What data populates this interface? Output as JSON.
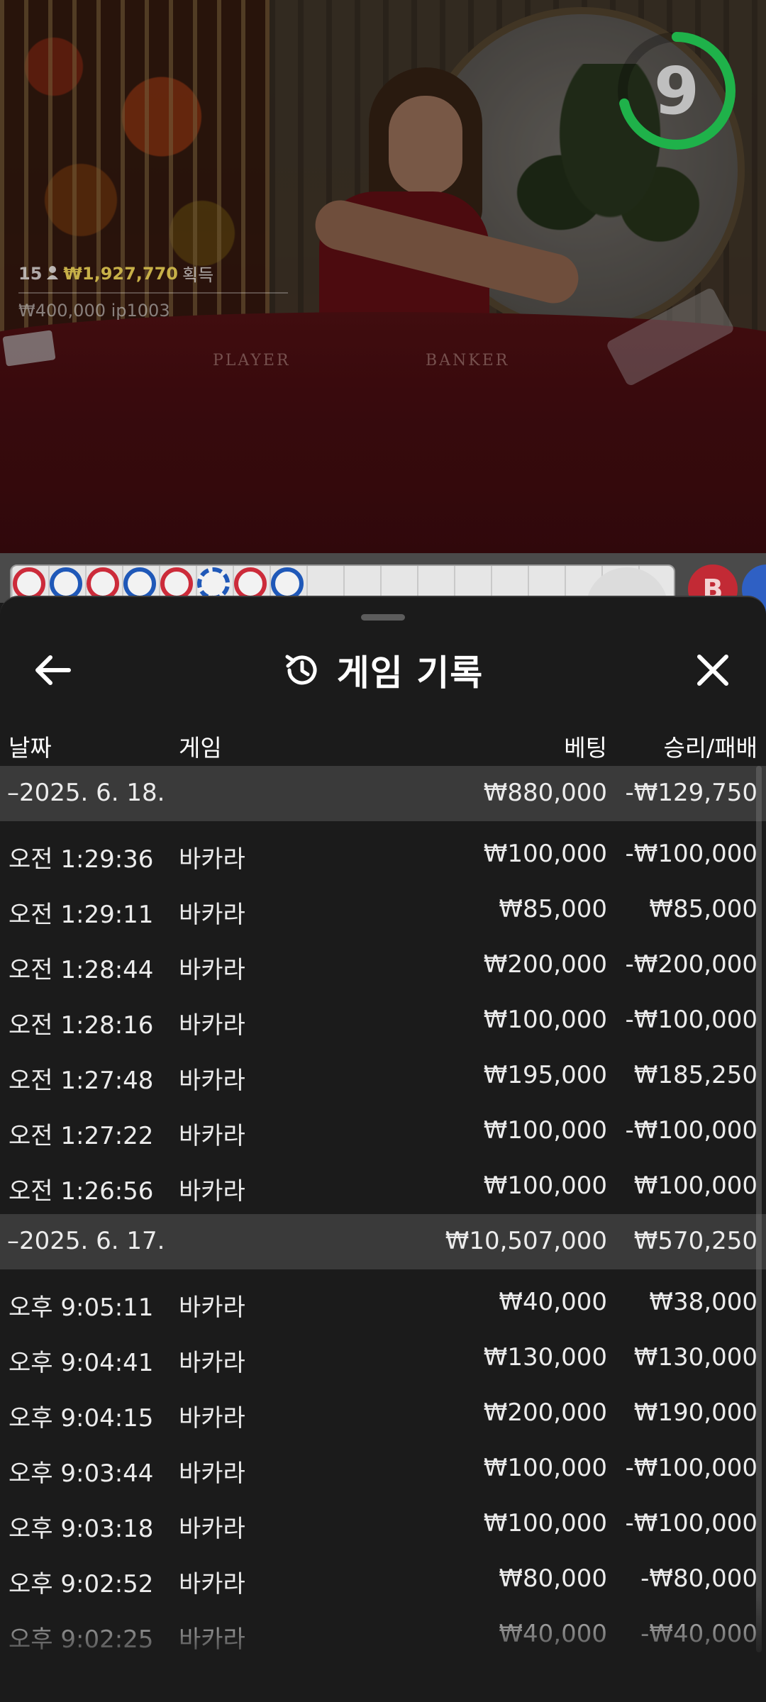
{
  "video": {
    "timer_value": "9",
    "stats": {
      "players": "15",
      "amount": "₩1,927,770",
      "label": "획득"
    },
    "user_line": "₩400,000 ip1003",
    "table_player": "PLAYER",
    "table_banker": "BANKER"
  },
  "road": {
    "dots": [
      "r",
      "b",
      "r",
      "b",
      "r",
      "t",
      "r",
      "b"
    ],
    "side_letter": "B"
  },
  "sheet": {
    "title": "게임 기록",
    "columns": {
      "date": "날짜",
      "game": "게임",
      "bet": "베팅",
      "winloss": "승리/패배"
    },
    "rows": [
      {
        "type": "group",
        "date": "–2025. 6. 18.",
        "bet": "₩880,000",
        "winloss": "-₩129,750"
      },
      {
        "type": "item",
        "date": "오전 1:29:36",
        "game": "바카라",
        "bet": "₩100,000",
        "winloss": "-₩100,000"
      },
      {
        "type": "item",
        "date": "오전 1:29:11",
        "game": "바카라",
        "bet": "₩85,000",
        "winloss": "₩85,000"
      },
      {
        "type": "item",
        "date": "오전 1:28:44",
        "game": "바카라",
        "bet": "₩200,000",
        "winloss": "-₩200,000"
      },
      {
        "type": "item",
        "date": "오전 1:28:16",
        "game": "바카라",
        "bet": "₩100,000",
        "winloss": "-₩100,000"
      },
      {
        "type": "item",
        "date": "오전 1:27:48",
        "game": "바카라",
        "bet": "₩195,000",
        "winloss": "₩185,250"
      },
      {
        "type": "item",
        "date": "오전 1:27:22",
        "game": "바카라",
        "bet": "₩100,000",
        "winloss": "-₩100,000"
      },
      {
        "type": "item",
        "date": "오전 1:26:56",
        "game": "바카라",
        "bet": "₩100,000",
        "winloss": "₩100,000"
      },
      {
        "type": "group",
        "date": "–2025. 6. 17.",
        "bet": "₩10,507,000",
        "winloss": "₩570,250"
      },
      {
        "type": "item",
        "date": "오후 9:05:11",
        "game": "바카라",
        "bet": "₩40,000",
        "winloss": "₩38,000"
      },
      {
        "type": "item",
        "date": "오후 9:04:41",
        "game": "바카라",
        "bet": "₩130,000",
        "winloss": "₩130,000"
      },
      {
        "type": "item",
        "date": "오후 9:04:15",
        "game": "바카라",
        "bet": "₩200,000",
        "winloss": "₩190,000"
      },
      {
        "type": "item",
        "date": "오후 9:03:44",
        "game": "바카라",
        "bet": "₩100,000",
        "winloss": "-₩100,000"
      },
      {
        "type": "item",
        "date": "오후 9:03:18",
        "game": "바카라",
        "bet": "₩100,000",
        "winloss": "-₩100,000"
      },
      {
        "type": "item",
        "date": "오후 9:02:52",
        "game": "바카라",
        "bet": "₩80,000",
        "winloss": "-₩80,000"
      },
      {
        "type": "item",
        "date": "오후 9:02:25",
        "game": "바카라",
        "bet": "₩40,000",
        "winloss": "-₩40,000"
      }
    ]
  },
  "colors": {
    "background": "#1b1b1b",
    "group_row": "#3a3a3a",
    "timer_ring": "#1fb24a",
    "road_red": "#cc2b3a",
    "road_blue": "#1f58b8"
  }
}
